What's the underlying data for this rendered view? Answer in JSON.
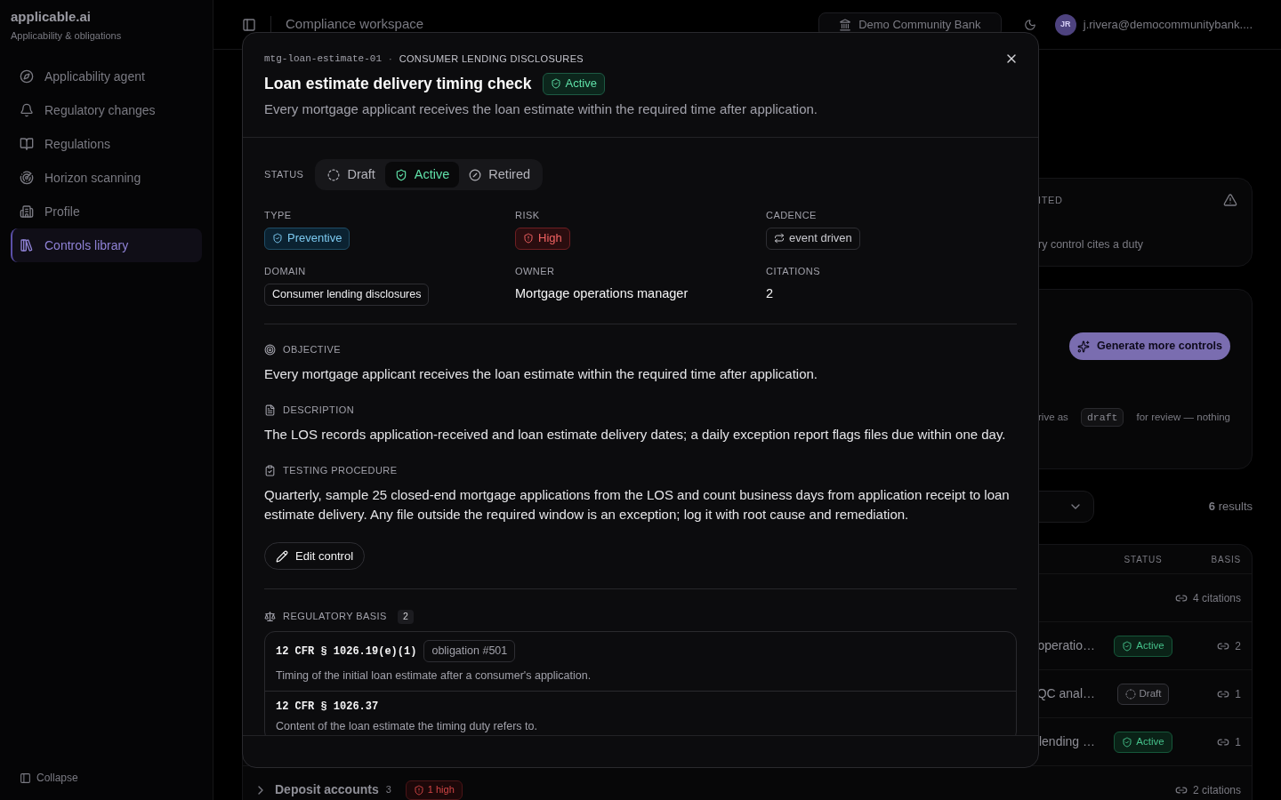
{
  "sidebar": {
    "brand": "applicable.ai",
    "tagline": "Applicability & obligations",
    "items": [
      {
        "label": "Applicability agent",
        "selected": false
      },
      {
        "label": "Regulatory changes",
        "selected": false
      },
      {
        "label": "Regulations",
        "selected": false
      },
      {
        "label": "Horizon scanning",
        "selected": false
      },
      {
        "label": "Profile",
        "selected": false
      },
      {
        "label": "Controls library",
        "selected": true
      }
    ],
    "collapse": "Collapse"
  },
  "topbar": {
    "title": "Compliance workspace",
    "organization": "Demo Community Bank",
    "avatar": "JR",
    "user": "j.rivera@democommunitybank...."
  },
  "workspace": {
    "coverage_card": {
      "label": "ITED",
      "text": "ry control cites a duty"
    },
    "generate_card": {
      "button": "Generate more controls",
      "note": [
        "rive as",
        "draft",
        "for review — nothing"
      ]
    },
    "results": "**6** results",
    "table": {
      "columns": [
        "STATUS",
        "BASIS"
      ],
      "rows": [
        {
          "kind": "group",
          "basis": "4 citations"
        },
        {
          "kind": "control",
          "name": "operatio…",
          "status": {
            "label": "Active",
            "kind": "active"
          },
          "basis": "2"
        },
        {
          "kind": "control",
          "name": "QC anal…",
          "status": {
            "label": "Draft",
            "kind": "draft"
          },
          "basis": "1"
        },
        {
          "kind": "control",
          "name": "lending …",
          "status": {
            "label": "Active",
            "kind": "active"
          },
          "basis": "1"
        },
        {
          "kind": "group",
          "name": "Deposit accounts",
          "count": "3",
          "risk": "1 high",
          "basis": "2 citations"
        }
      ]
    }
  },
  "dialog": {
    "control_id": "mtg-loan-estimate-01",
    "separator": "·",
    "category": "CONSUMER LENDING DISCLOSURES",
    "title": "Loan estimate delivery timing check",
    "status_badge": "Active",
    "summary": "Every mortgage applicant receives the loan estimate within the required time after application.",
    "status": {
      "label": "STATUS",
      "options": [
        {
          "label": "Draft",
          "selected": false
        },
        {
          "label": "Active",
          "selected": true
        },
        {
          "label": "Retired",
          "selected": false
        }
      ]
    },
    "fields": [
      {
        "kind": "type-badge",
        "label": "TYPE",
        "value": "Preventive"
      },
      {
        "kind": "risk-badge",
        "label": "RISK",
        "value": "High"
      },
      {
        "kind": "cadence-chip",
        "label": "CADENCE",
        "value": "event driven"
      },
      {
        "kind": "chip",
        "label": "DOMAIN",
        "value": "Consumer lending disclosures"
      },
      {
        "kind": "text",
        "label": "OWNER",
        "value": "Mortgage operations manager"
      },
      {
        "kind": "text",
        "label": "CITATIONS",
        "value": "2"
      }
    ],
    "sections": [
      {
        "kind": "objective",
        "title": "OBJECTIVE",
        "text": "Every mortgage applicant receives the loan estimate within the required time after application."
      },
      {
        "kind": "description",
        "title": "DESCRIPTION",
        "text": "The LOS records application-received and loan estimate delivery dates; a daily exception report flags files due within one day."
      },
      {
        "kind": "testing",
        "title": "TESTING PROCEDURE",
        "text": "Quarterly, sample 25 closed-end mortgage applications from the LOS and count business days from application receipt to loan estimate delivery. Any file outside the required window is an exception; log it with root cause and remediation."
      }
    ],
    "edit_button": "Edit control",
    "regulatory_basis": {
      "title": "REGULATORY BASIS",
      "count": "2",
      "citations": [
        {
          "reference": "12 CFR § 1026.19(e)(1)",
          "obligation": "obligation #501",
          "summary": "Timing of the initial loan estimate after a consumer's application."
        },
        {
          "reference": "12 CFR § 1026.37",
          "summary": "Content of the loan estimate the timing duty refers to."
        }
      ]
    }
  }
}
